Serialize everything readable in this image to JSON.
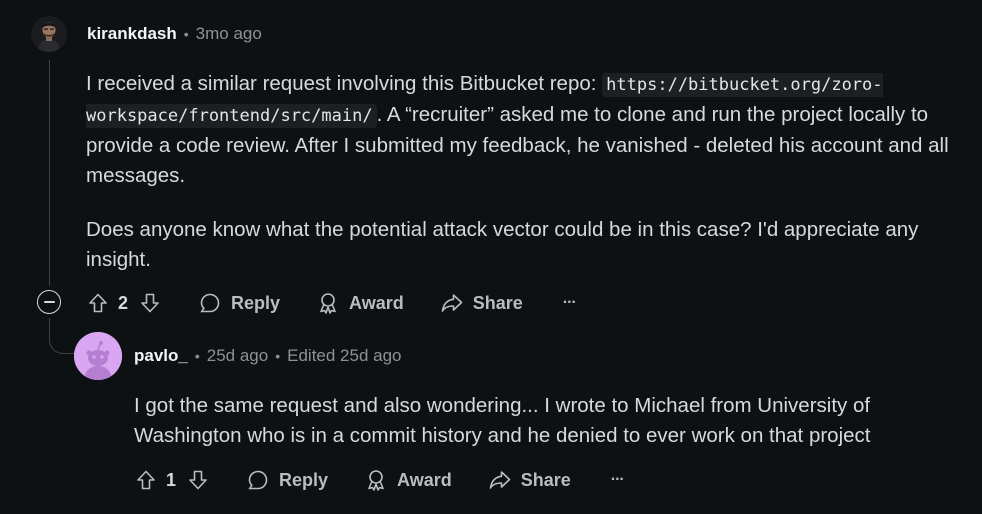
{
  "comments": [
    {
      "author": "kirankdash",
      "separator": "•",
      "time": "3mo ago",
      "paragraph1_lead": "I received a similar request involving this Bitbucket repo:",
      "repo_url": "https://bitbucket.org/zoro-workspace/frontend/src/main/",
      "paragraph1_tail": ". A “recruiter” asked me to clone and run the project locally to provide a code review. After I submitted my feedback, he vanished - deleted his account and all messages.",
      "paragraph2": "Does anyone know what the potential attack vector could be in this case? I'd appreciate any insight.",
      "votes": "2",
      "reply_label": "Reply",
      "award_label": "Award",
      "share_label": "Share",
      "more_label": "···"
    },
    {
      "author": "pavlo_",
      "separator": "•",
      "time": "25d ago",
      "separator2": "•",
      "edited": "Edited 25d ago",
      "text": "I got the same request and also wondering... I wrote to Michael from University of Washington who is in a commit history and he denied to ever work on that project",
      "votes": "1",
      "reply_label": "Reply",
      "award_label": "Award",
      "share_label": "Share",
      "more_label": "···"
    }
  ],
  "icons": {
    "upvote": "arrow-up-icon",
    "downvote": "arrow-down-icon",
    "reply": "speech-bubble-icon",
    "award": "award-icon",
    "share": "share-arrow-icon",
    "more": "ellipsis-icon",
    "collapse": "collapse-minus-icon"
  },
  "colors": {
    "background": "#0e1113",
    "text": "#d7dadc",
    "muted": "#8c9295",
    "thread_line": "#3e4347",
    "avatar_purple": "#d9a6f2"
  }
}
